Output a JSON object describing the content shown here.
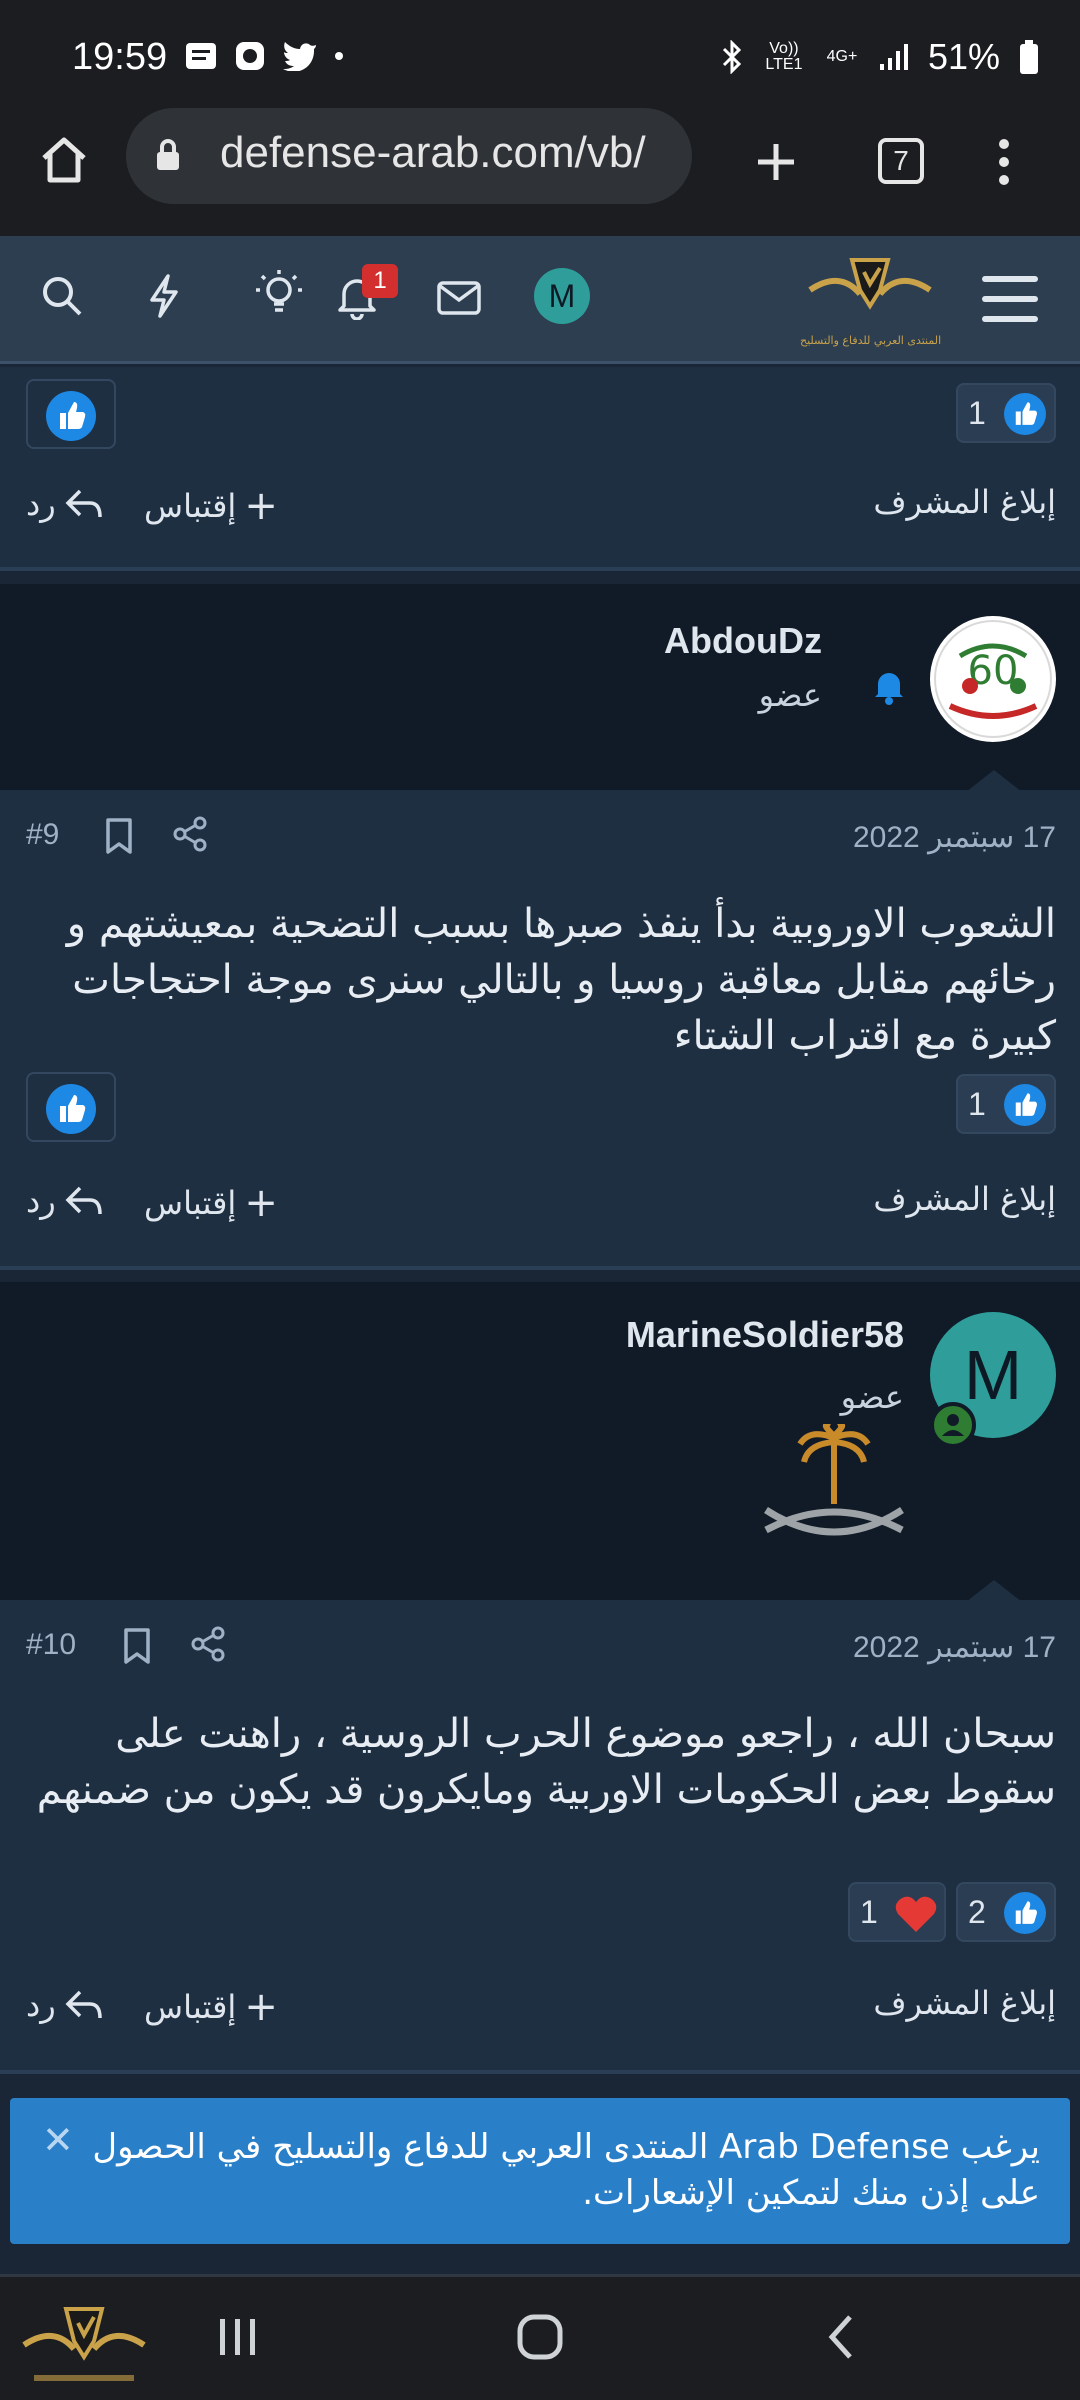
{
  "status_bar": {
    "time": "19:59",
    "battery": "51%",
    "network": "4G+",
    "volte": "Vo)) LTE1"
  },
  "browser": {
    "url": "defense-arab.com/vb/",
    "tab_count": "7"
  },
  "forum_header": {
    "notification_count": "1",
    "avatar_letter": "M",
    "logo_caption": "المنتدى العربي للدفاع والتسليح"
  },
  "top_actions": {
    "reaction_count": "1",
    "report": "إبلاغ المشرف",
    "quote": "إقتباس",
    "reply": "رد"
  },
  "posts": [
    {
      "username": "AbdouDz",
      "role": "عضو",
      "date": "17 سبتمبر 2022",
      "number": "#9",
      "text": "الشعوب الاوروبية بدأ ينفذ صبرها بسبب التضحية بمعيشتهم و رخائهم مقابل معاقبة روسيا و بالتالي سنرى موجة احتجاجات كبيرة مع اقتراب الشتاء",
      "like_count": "1",
      "report": "إبلاغ المشرف",
      "quote": "إقتباس",
      "reply": "رد",
      "avatar_colors": {
        "ring": "#ffffff",
        "accent": "#2e7d32"
      }
    },
    {
      "username": "MarineSoldier58",
      "role": "عضو",
      "avatar_letter": "M",
      "date": "17 سبتمبر 2022",
      "number": "#10",
      "text": "سبحان الله ، راجعو موضوع الحرب الروسية ، راهنت على سقوط بعض الحكومات الاوربية ومايكرون قد يكون من ضمنهم",
      "like_count": "2",
      "love_count": "1",
      "report": "إبلاغ المشرف",
      "quote": "إقتباس",
      "reply": "رد"
    }
  ],
  "notification_prompt": {
    "text": "يرغب Arab Defense المنتدى العربي للدفاع والتسليح في الحصول على إذن منك لتمكين الإشعارات."
  },
  "colors": {
    "accent_blue": "#1e88e5",
    "notice_blue": "#2a7fc9",
    "header_bg": "#2c3e50",
    "post_bg": "#1f2f42",
    "user_band_bg": "#111b27"
  }
}
